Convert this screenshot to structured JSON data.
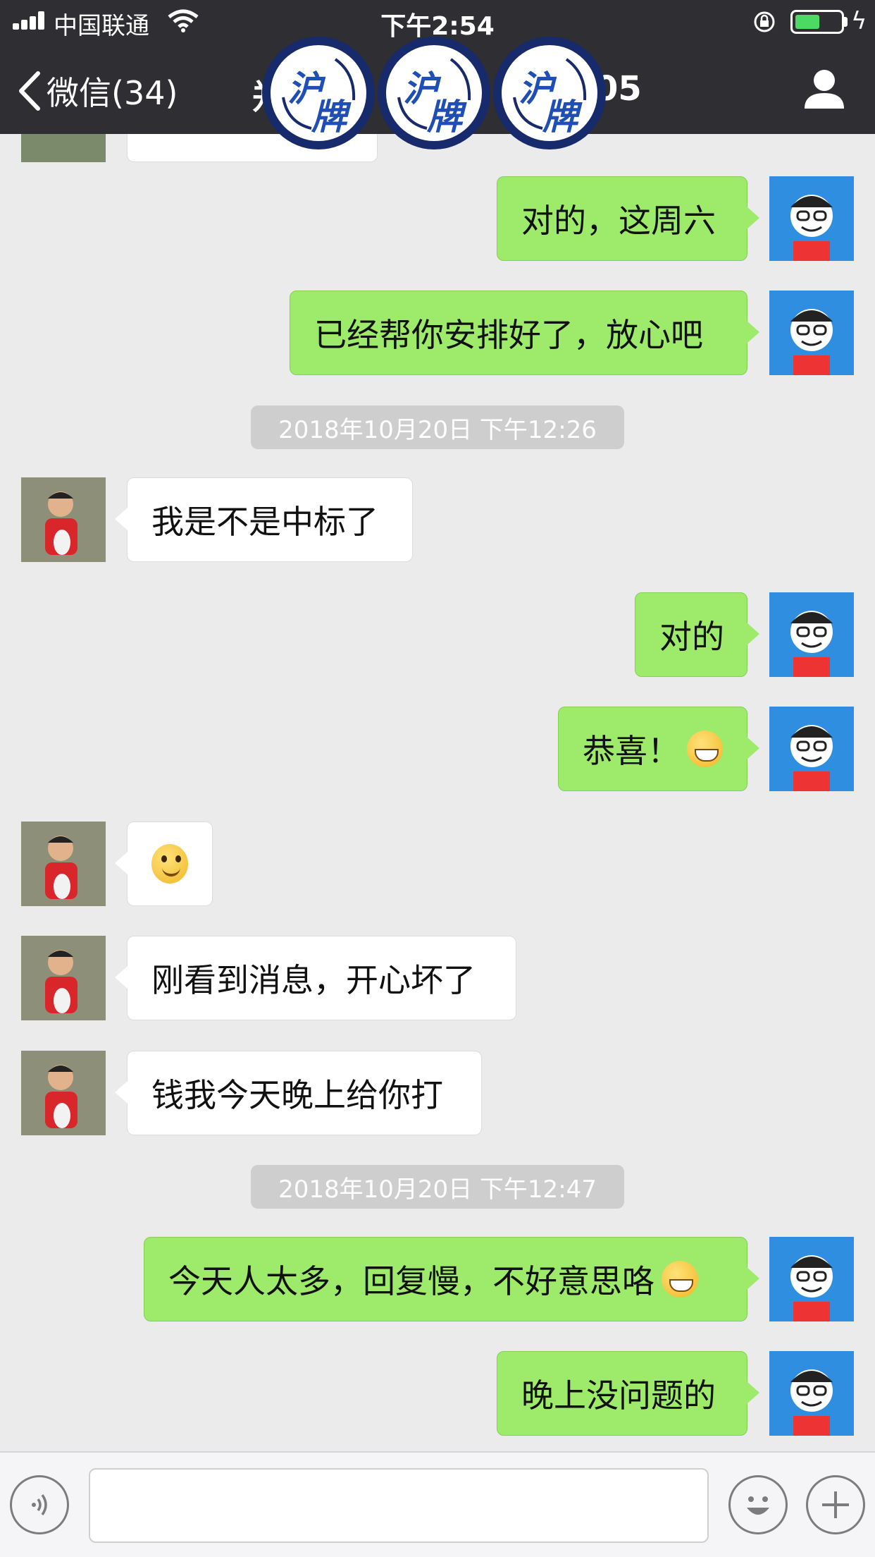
{
  "status_bar": {
    "carrier": "中国联通",
    "time": "下午2:54"
  },
  "nav": {
    "back_label": "微信(34)",
    "title_left": "郑",
    "title_right": "05",
    "watermark_text": [
      "沪牌",
      "沪牌",
      "沪牌"
    ]
  },
  "messages": [
    {
      "type": "mine",
      "text": "对的，这周六"
    },
    {
      "type": "mine",
      "text": "已经帮你安排好了，放心吧"
    },
    {
      "type": "time",
      "text": "2018年10月20日 下午12:26"
    },
    {
      "type": "theirs",
      "text": "我是不是中标了"
    },
    {
      "type": "mine",
      "text": "对的"
    },
    {
      "type": "mine",
      "text": "恭喜！",
      "emoji": "grin-emoji"
    },
    {
      "type": "theirs",
      "text": "",
      "emoji": "smile-emoji"
    },
    {
      "type": "theirs",
      "text": "刚看到消息，开心坏了"
    },
    {
      "type": "theirs",
      "text": "钱我今天晚上给你打"
    },
    {
      "type": "time",
      "text": "2018年10月20日 下午12:47"
    },
    {
      "type": "mine",
      "text": "今天人太多，回复慢，不好意思咯",
      "emoji": "grin-emoji"
    },
    {
      "type": "mine",
      "text": "晚上没问题的"
    }
  ],
  "input": {
    "value": "",
    "voice_icon": "voice-icon",
    "emoji_icon": "emoji-icon",
    "plus_icon": "plus-icon"
  },
  "colors": {
    "header_bg": "#2e2e33",
    "chat_bg": "#ebebeb",
    "my_bubble": "#9eea6a",
    "their_bubble": "#ffffff",
    "timestamp_bg": "#cecece",
    "badge_ring": "#172a6b",
    "badge_text": "#1f4fb4"
  }
}
